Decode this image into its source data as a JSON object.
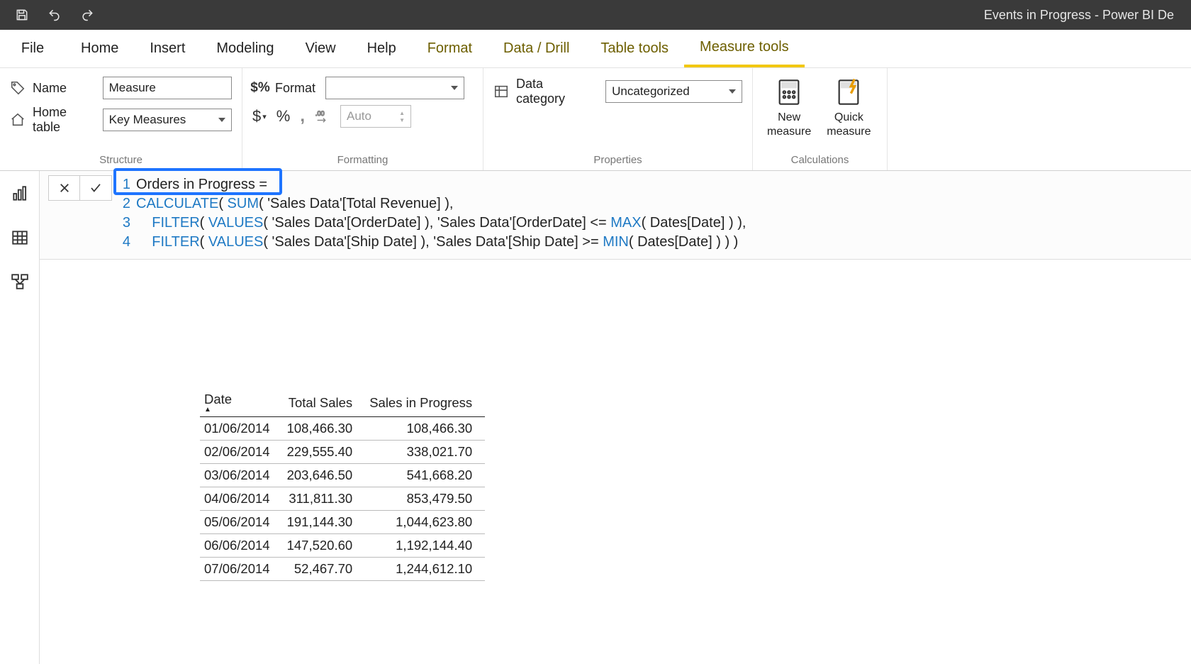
{
  "window": {
    "title": "Events in Progress - Power BI De"
  },
  "qat": {
    "save": "save",
    "undo": "undo",
    "redo": "redo"
  },
  "tabs": {
    "file": "File",
    "items": [
      {
        "label": "Home",
        "contextual": false,
        "active": false
      },
      {
        "label": "Insert",
        "contextual": false,
        "active": false
      },
      {
        "label": "Modeling",
        "contextual": false,
        "active": false
      },
      {
        "label": "View",
        "contextual": false,
        "active": false
      },
      {
        "label": "Help",
        "contextual": false,
        "active": false
      },
      {
        "label": "Format",
        "contextual": true,
        "active": false
      },
      {
        "label": "Data / Drill",
        "contextual": true,
        "active": false
      },
      {
        "label": "Table tools",
        "contextual": true,
        "active": false
      },
      {
        "label": "Measure tools",
        "contextual": true,
        "active": true
      }
    ]
  },
  "ribbon": {
    "structure": {
      "group_label": "Structure",
      "name_label": "Name",
      "name_value": "Measure",
      "hometable_label": "Home table",
      "hometable_value": "Key Measures"
    },
    "formatting": {
      "group_label": "Formatting",
      "format_label": "Format",
      "format_value": "",
      "currency": "$",
      "percent": "%",
      "thousands": ",",
      "decimal_inc": ".00→.0",
      "decimal_value": "Auto"
    },
    "properties": {
      "group_label": "Properties",
      "datacat_label": "Data category",
      "datacat_value": "Uncategorized"
    },
    "calculations": {
      "group_label": "Calculations",
      "new_measure": "New\nmeasure",
      "quick_measure": "Quick\nmeasure"
    }
  },
  "formula": {
    "cancel": "✕",
    "commit": "✓",
    "lines": [
      {
        "n": "1",
        "pre": "",
        "fn": "",
        "text": "Orders in Progress ="
      },
      {
        "n": "2",
        "segments": [
          {
            "t": "fn",
            "v": "CALCULATE"
          },
          {
            "t": "p",
            "v": "( "
          },
          {
            "t": "fn",
            "v": "SUM"
          },
          {
            "t": "p",
            "v": "( 'Sales Data'[Total Revenue] ),"
          }
        ]
      },
      {
        "n": "3",
        "segments": [
          {
            "t": "p",
            "v": "    "
          },
          {
            "t": "fn",
            "v": "FILTER"
          },
          {
            "t": "p",
            "v": "( "
          },
          {
            "t": "fn",
            "v": "VALUES"
          },
          {
            "t": "p",
            "v": "( 'Sales Data'[OrderDate] ), 'Sales Data'[OrderDate] <= "
          },
          {
            "t": "fn",
            "v": "MAX"
          },
          {
            "t": "p",
            "v": "( Dates[Date] ) ),"
          }
        ]
      },
      {
        "n": "4",
        "segments": [
          {
            "t": "p",
            "v": "    "
          },
          {
            "t": "fn",
            "v": "FILTER"
          },
          {
            "t": "p",
            "v": "( "
          },
          {
            "t": "fn",
            "v": "VALUES"
          },
          {
            "t": "p",
            "v": "( 'Sales Data'[Ship Date] ), 'Sales Data'[Ship Date] >= "
          },
          {
            "t": "fn",
            "v": "MIN"
          },
          {
            "t": "p",
            "v": "( Dates[Date] ) ) )"
          }
        ]
      }
    ]
  },
  "table": {
    "columns": [
      {
        "label": "Date",
        "align": "left",
        "sorted": true
      },
      {
        "label": "Total Sales",
        "align": "right",
        "sorted": false
      },
      {
        "label": "Sales in Progress",
        "align": "right",
        "sorted": false
      }
    ],
    "rows": [
      [
        "01/06/2014",
        "108,466.30",
        "108,466.30"
      ],
      [
        "02/06/2014",
        "229,555.40",
        "338,021.70"
      ],
      [
        "03/06/2014",
        "203,646.50",
        "541,668.20"
      ],
      [
        "04/06/2014",
        "311,811.30",
        "853,479.50"
      ],
      [
        "05/06/2014",
        "191,144.30",
        "1,044,623.80"
      ],
      [
        "06/06/2014",
        "147,520.60",
        "1,192,144.40"
      ],
      [
        "07/06/2014",
        "52,467.70",
        "1,244,612.10"
      ]
    ]
  }
}
